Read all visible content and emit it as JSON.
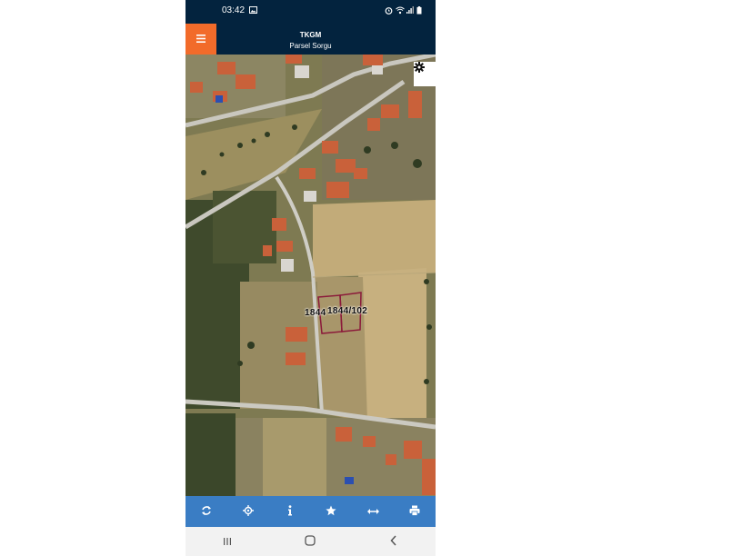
{
  "status_bar": {
    "time": "03:42"
  },
  "app_bar": {
    "title": "TKGM",
    "subtitle": "Parsel Sorgu"
  },
  "map": {
    "parcel_labels": [
      "1844",
      "1844/102"
    ]
  },
  "toolbar": {
    "items": [
      "refresh-icon",
      "locate-icon",
      "info-icon",
      "star-icon",
      "measure-icon",
      "print-icon"
    ]
  },
  "colors": {
    "header": "#03233e",
    "menu_button": "#f26b2a",
    "toolbar": "#3a7dc4",
    "parcel_outline": "#8b1a3a"
  }
}
